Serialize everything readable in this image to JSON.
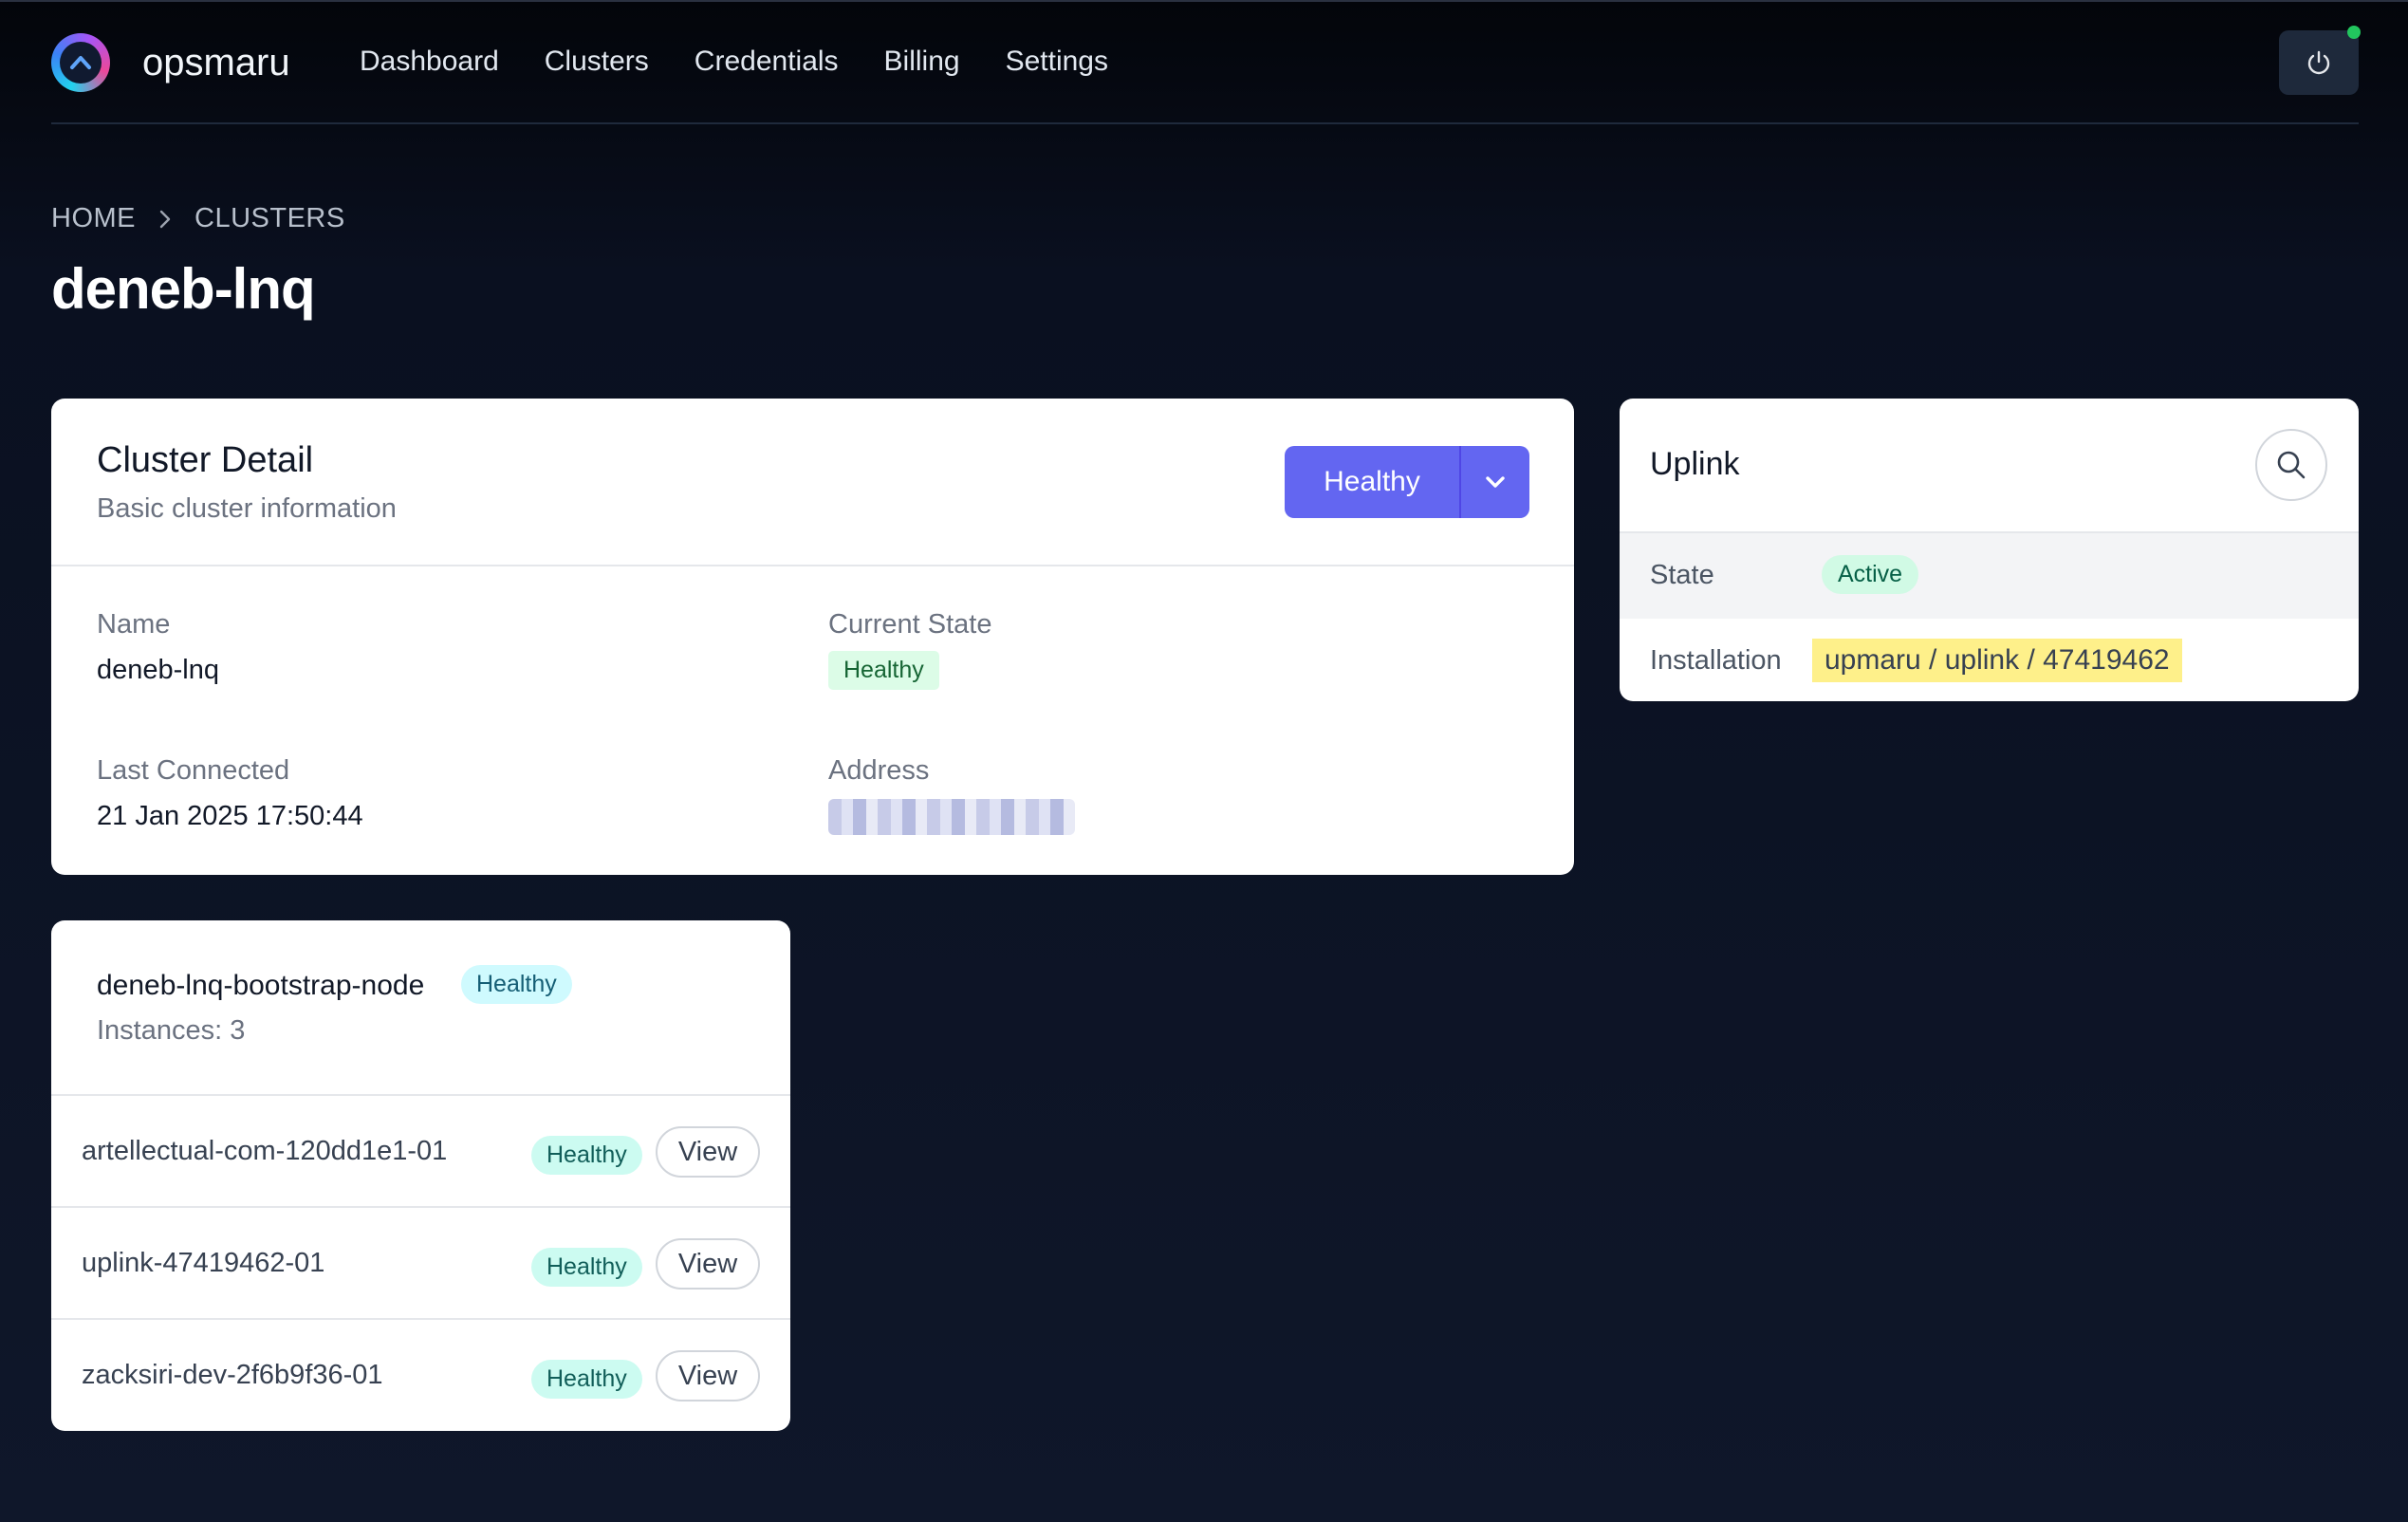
{
  "app": {
    "brand": "opsmaru"
  },
  "nav": {
    "items": [
      "Dashboard",
      "Clusters",
      "Credentials",
      "Billing",
      "Settings"
    ]
  },
  "breadcrumb": {
    "home": "HOME",
    "current": "CLUSTERS"
  },
  "page": {
    "title": "deneb-lnq"
  },
  "cluster_detail": {
    "title": "Cluster Detail",
    "subtitle": "Basic cluster information",
    "status_button": "Healthy",
    "fields": {
      "name_label": "Name",
      "name_value": "deneb-lnq",
      "state_label": "Current State",
      "state_value": "Healthy",
      "last_connected_label": "Last Connected",
      "last_connected_value": "21 Jan 2025 17:50:44",
      "address_label": "Address"
    }
  },
  "uplink": {
    "title": "Uplink",
    "state_label": "State",
    "state_value": "Active",
    "installation_label": "Installation",
    "installation_value": "upmaru / uplink / 47419462"
  },
  "node_group": {
    "name": "deneb-lnq-bootstrap-node",
    "status": "Healthy",
    "instances": "Instances: 3",
    "rows": [
      {
        "name": "artellectual-com-120dd1e1-01",
        "status": "Healthy",
        "action": "View"
      },
      {
        "name": "uplink-47419462-01",
        "status": "Healthy",
        "action": "View"
      },
      {
        "name": "zacksiri-dev-2f6b9f36-01",
        "status": "Healthy",
        "action": "View"
      }
    ]
  },
  "colors": {
    "accent": "#6366f1",
    "online": "#22c55e",
    "highlight": "#fef08a"
  }
}
